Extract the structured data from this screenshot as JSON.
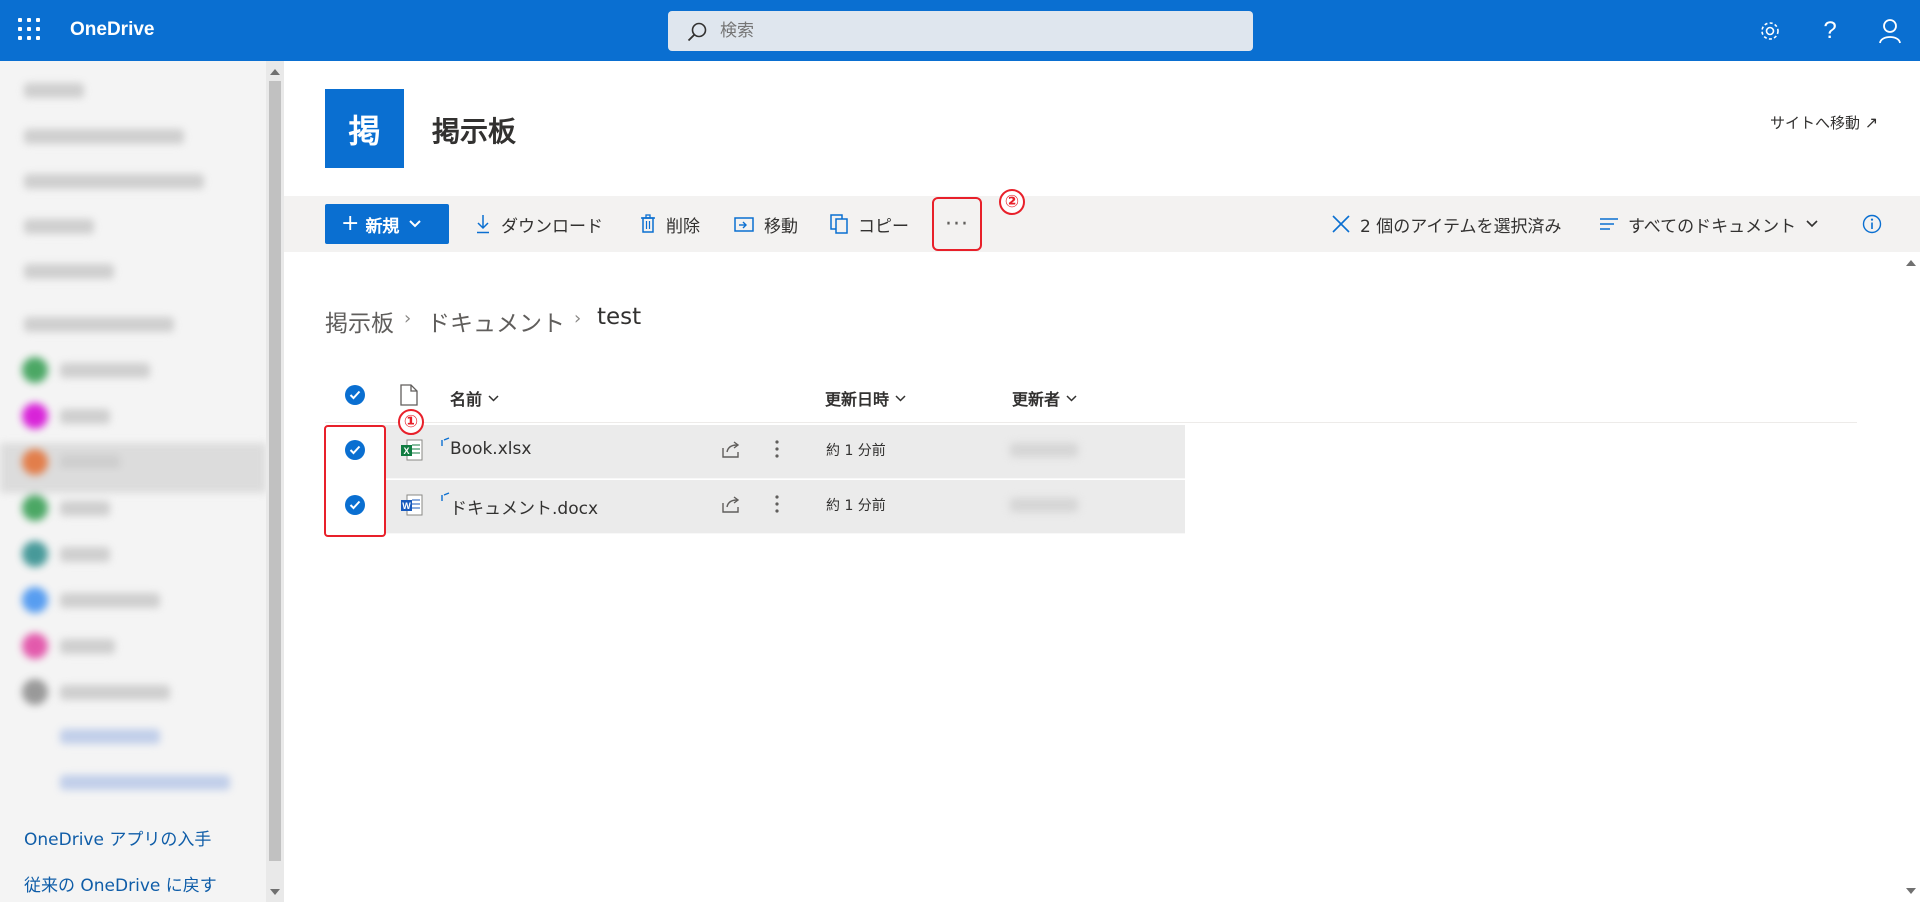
{
  "topbar": {
    "app_title": "OneDrive",
    "search_placeholder": "検索",
    "icons": [
      "app-launcher-icon",
      "search-icon",
      "settings-icon",
      "help-icon",
      "account-icon"
    ]
  },
  "sidebar": {
    "footer_links": [
      "OneDrive アプリの入手",
      "従来の OneDrive に戻す"
    ]
  },
  "site": {
    "logo_letter": "掲",
    "name": "掲示板",
    "goto_label": "サイトへ移動"
  },
  "commandbar": {
    "new_label": "新規",
    "download_label": "ダウンロード",
    "delete_label": "削除",
    "move_label": "移動",
    "copy_label": "コピー",
    "more_label": "···",
    "selection_label": "2 個のアイテムを選択済み",
    "view_label": "すべてのドキュメント"
  },
  "breadcrumb": [
    "掲示板",
    "ドキュメント",
    "test"
  ],
  "list": {
    "columns": {
      "name": "名前",
      "modified": "更新日時",
      "modified_by": "更新者"
    },
    "rows": [
      {
        "name": "Book.xlsx",
        "modified": "約 1 分前",
        "type": "excel",
        "selected": true
      },
      {
        "name": "ドキュメント.docx",
        "modified": "約 1 分前",
        "type": "word",
        "selected": true
      }
    ]
  },
  "annotations": {
    "step1": "①",
    "step2": "②"
  },
  "colors": {
    "brand": "#0a6fd1",
    "annotation": "#e8202a"
  }
}
